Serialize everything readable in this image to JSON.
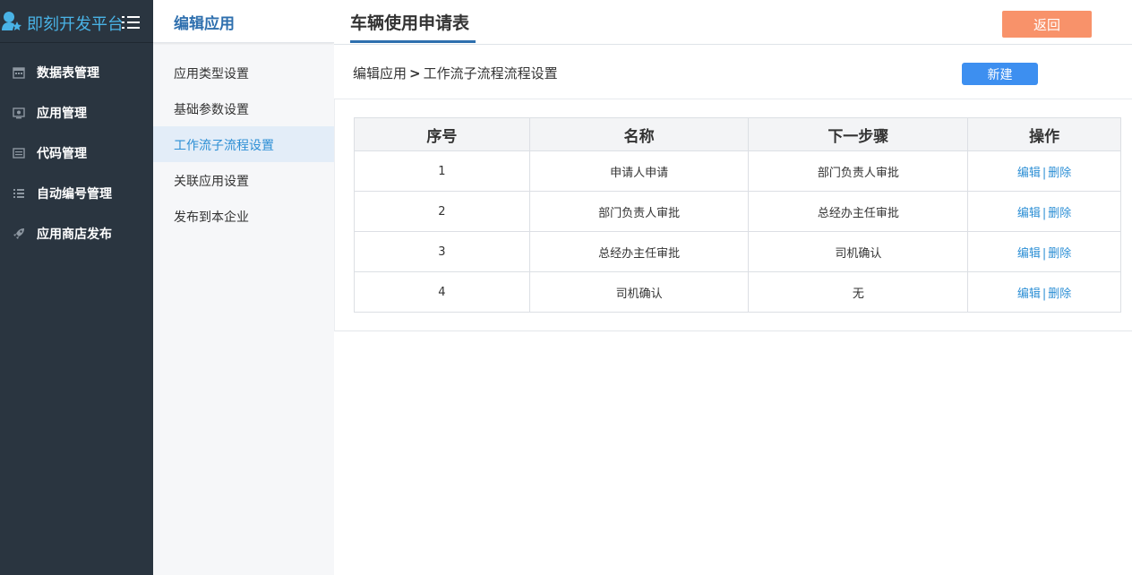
{
  "brand": {
    "title": "即刻开发平台",
    "icon": "user-star-icon"
  },
  "sidebar": {
    "items": [
      {
        "label": "数据表管理",
        "icon": "calendar-icon"
      },
      {
        "label": "应用管理",
        "icon": "monitor-icon"
      },
      {
        "label": "代码管理",
        "icon": "list-box-icon"
      },
      {
        "label": "自动编号管理",
        "icon": "list-icon"
      },
      {
        "label": "应用商店发布",
        "icon": "rocket-icon"
      }
    ]
  },
  "subnav": {
    "title": "编辑应用",
    "items": [
      {
        "label": "应用类型设置",
        "active": false
      },
      {
        "label": "基础参数设置",
        "active": false
      },
      {
        "label": "工作流子流程设置",
        "active": true
      },
      {
        "label": "关联应用设置",
        "active": false
      },
      {
        "label": "发布到本企业",
        "active": false
      }
    ]
  },
  "main": {
    "title": "车辆使用申请表",
    "back_label": "返回",
    "breadcrumb": {
      "parent": "编辑应用",
      "separator": ">",
      "current": "工作流子流程流程设置"
    },
    "new_label": "新建",
    "table": {
      "headers": [
        "序号",
        "名称",
        "下一步骤",
        "操作"
      ],
      "rows": [
        {
          "no": "1",
          "name": "申请人申请",
          "next": "部门负责人审批"
        },
        {
          "no": "2",
          "name": "部门负责人审批",
          "next": "总经办主任审批"
        },
        {
          "no": "3",
          "name": "总经办主任审批",
          "next": "司机确认"
        },
        {
          "no": "4",
          "name": "司机确认",
          "next": "无"
        }
      ],
      "edit_label": "编辑",
      "op_separator": "|",
      "delete_label": "删除"
    }
  },
  "colors": {
    "sidebar_bg": "#2a3540",
    "brand_text": "#49b3e6",
    "accent": "#2e6fae",
    "link": "#2d8fd5",
    "back_button": "#f8926a",
    "new_button": "#3d8ff0",
    "active_bg": "#e3edf8"
  }
}
